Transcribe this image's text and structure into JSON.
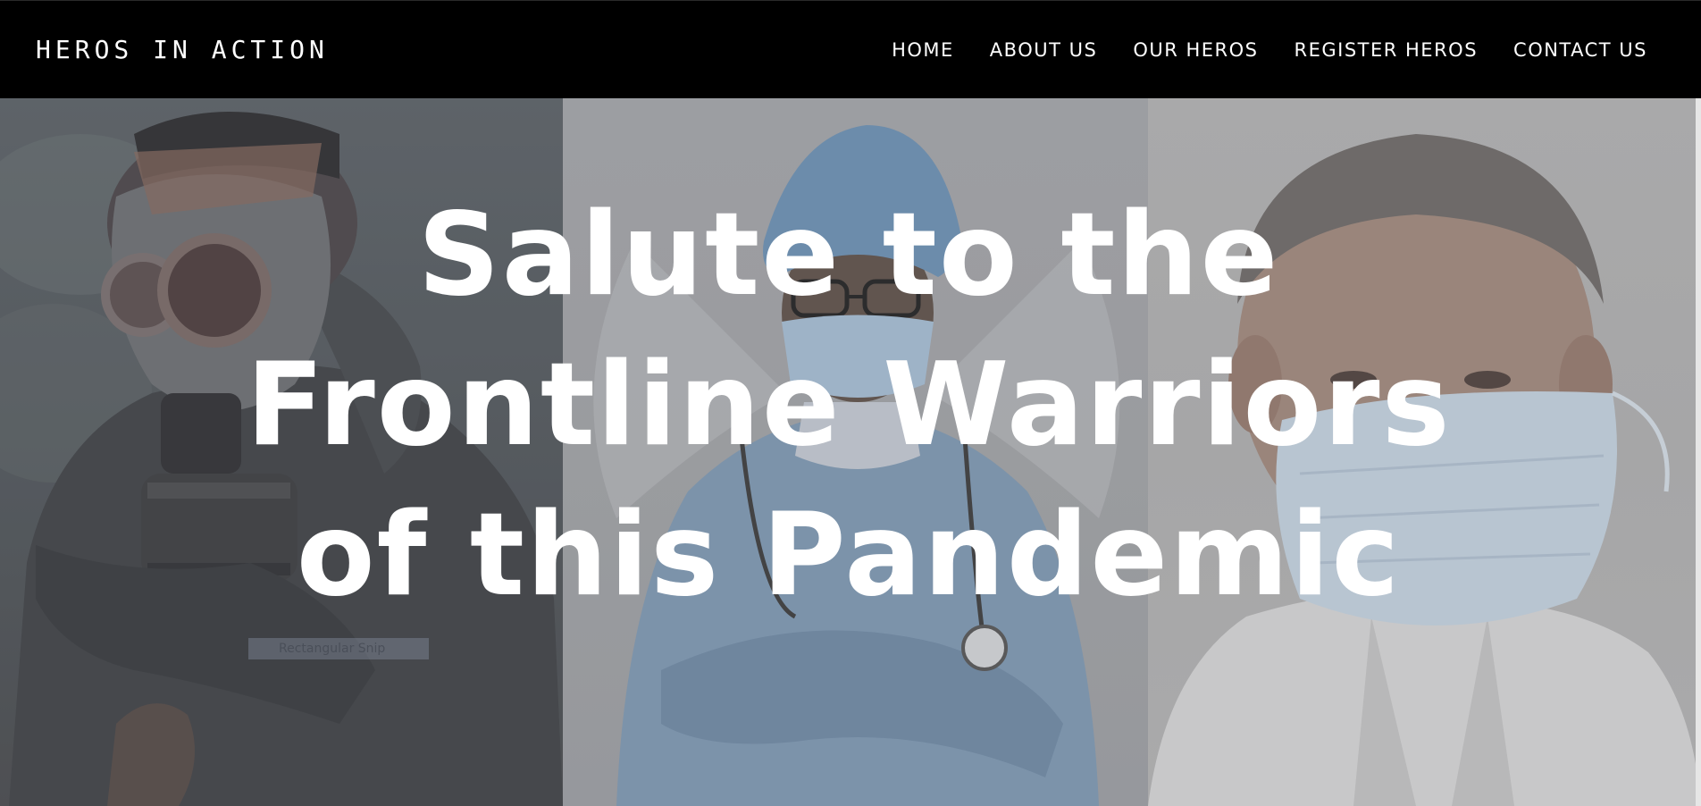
{
  "header": {
    "brand": "HEROS IN ACTION",
    "nav": [
      {
        "label": "HOME"
      },
      {
        "label": "ABOUT US"
      },
      {
        "label": "OUR HEROS"
      },
      {
        "label": "REGISTER HEROS"
      },
      {
        "label": "CONTACT US"
      }
    ]
  },
  "hero": {
    "headline_lines": [
      "Salute to the",
      "Frontline Warriors",
      "of this Pandemic"
    ],
    "panels": [
      {
        "subject": "person-in-gas-mask"
      },
      {
        "subject": "healthcare-worker-with-stethoscope"
      },
      {
        "subject": "doctor-wearing-face-mask"
      }
    ],
    "snip_label": "Rectangular Snip"
  },
  "colors": {
    "nav_background": "#000000",
    "text": "#ffffff",
    "scrub_blue": "#7f9bb6",
    "mask_blue": "#c9d8e6"
  }
}
